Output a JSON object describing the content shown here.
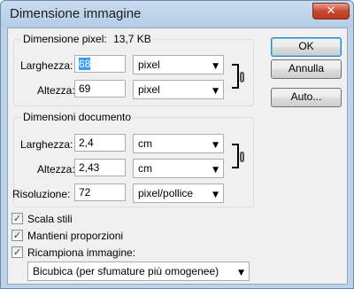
{
  "window": {
    "title": "Dimensione immagine",
    "close_glyph": "✕"
  },
  "pixel_dims": {
    "title": "Dimensione pixel:",
    "size": "13,7 KB",
    "width_label": "Larghezza:",
    "width_value": "68",
    "width_unit": "pixel",
    "height_label": "Altezza:",
    "height_value": "69",
    "height_unit": "pixel"
  },
  "doc_dims": {
    "title": "Dimensioni documento",
    "width_label": "Larghezza:",
    "width_value": "2,4",
    "width_unit": "cm",
    "height_label": "Altezza:",
    "height_value": "2,43",
    "height_unit": "cm",
    "res_label": "Risoluzione:",
    "res_value": "72",
    "res_unit": "pixel/pollice"
  },
  "buttons": {
    "ok": "OK",
    "cancel": "Annulla",
    "auto": "Auto..."
  },
  "options": {
    "scale_styles": {
      "label": "Scala stili",
      "checked": true
    },
    "constrain": {
      "label": "Mantieni proporzioni",
      "checked": true
    },
    "resample": {
      "label": "Ricampiona immagine:",
      "checked": true
    },
    "resample_method": "Bicubica (per sfumature più omogenee)"
  },
  "icons": {
    "dropdown_arrow": "▼",
    "check_mark": "✓",
    "link": "link-icon"
  }
}
